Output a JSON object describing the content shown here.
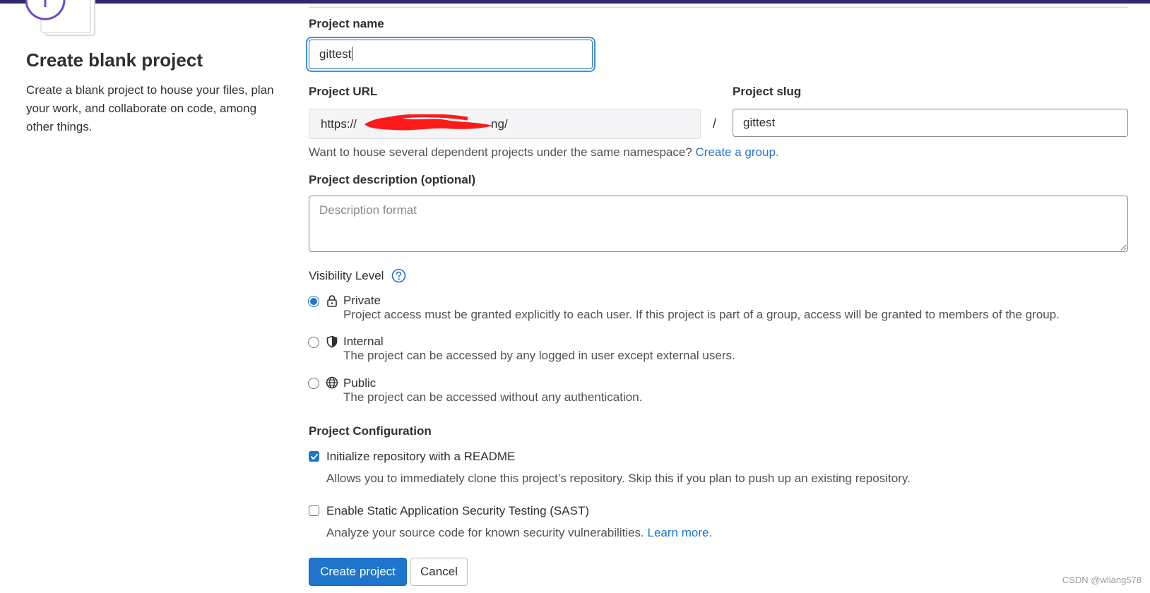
{
  "colors": {
    "accent": "#1f75cb",
    "topbar": "#2f2a6b",
    "illustration": "#6e49cb",
    "redaction": "#ff1a1a"
  },
  "left": {
    "title": "Create blank project",
    "description": "Create a blank project to house your files, plan your work, and collaborate on code, among other things."
  },
  "form": {
    "project_name": {
      "label": "Project name",
      "value": "gittest"
    },
    "project_url": {
      "label": "Project URL",
      "prefix": "https://",
      "suffix": "ng/"
    },
    "separator": "/",
    "project_slug": {
      "label": "Project slug",
      "value": "gittest"
    },
    "namespace_help": {
      "text": "Want to house several dependent projects under the same namespace?",
      "link": "Create a group."
    },
    "description": {
      "label": "Project description (optional)",
      "placeholder": "Description format"
    },
    "visibility": {
      "label": "Visibility Level",
      "help_icon": "question-circle-icon",
      "options": [
        {
          "title": "Private",
          "icon": "lock-icon",
          "checked": true,
          "desc": "Project access must be granted explicitly to each user. If this project is part of a group, access will be granted to members of the group."
        },
        {
          "title": "Internal",
          "icon": "shield-icon",
          "checked": false,
          "desc": "The project can be accessed by any logged in user except external users."
        },
        {
          "title": "Public",
          "icon": "globe-icon",
          "checked": false,
          "desc": "The project can be accessed without any authentication."
        }
      ]
    },
    "configuration": {
      "label": "Project Configuration",
      "readme": {
        "label": "Initialize repository with a README",
        "checked": true,
        "desc": "Allows you to immediately clone this project’s repository. Skip this if you plan to push up an existing repository."
      },
      "sast": {
        "label": "Enable Static Application Security Testing (SAST)",
        "checked": false,
        "desc": "Analyze your source code for known security vulnerabilities.",
        "link": "Learn more."
      }
    },
    "buttons": {
      "create": "Create project",
      "cancel": "Cancel"
    }
  },
  "watermark": "CSDN @wliang578"
}
